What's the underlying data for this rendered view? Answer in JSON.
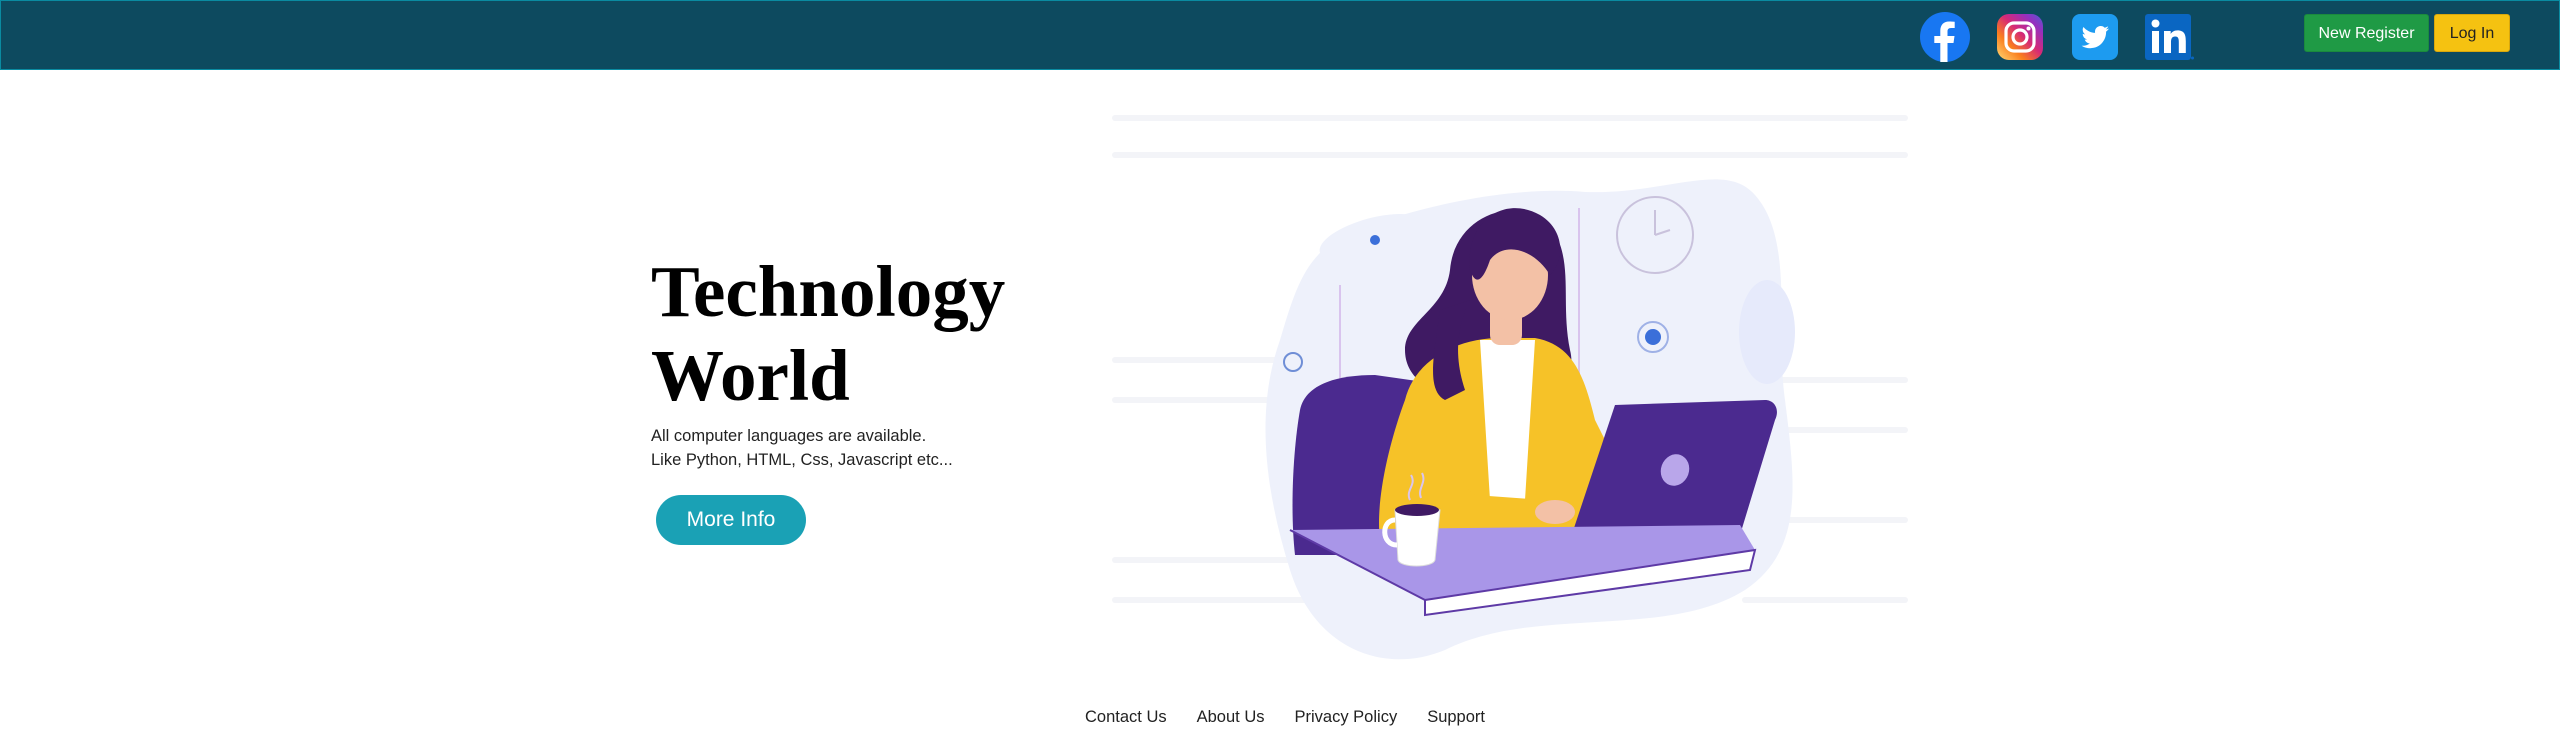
{
  "header": {
    "social": [
      {
        "icon": "facebook-icon",
        "color": "#1877f2"
      },
      {
        "icon": "instagram-icon",
        "color": "#c13584"
      },
      {
        "icon": "twitter-icon",
        "color": "#1d9bf0"
      },
      {
        "icon": "linkedin-icon",
        "color": "#0a66c2"
      }
    ],
    "register_label": "New Register",
    "login_label": "Log In",
    "colors": {
      "bar": "#0d4a5f",
      "register": "#1f9a45",
      "login": "#f5c211"
    }
  },
  "hero": {
    "title_line1": "Technology",
    "title_line2": "World",
    "desc_line1": "All computer languages are available.",
    "desc_line2": "Like Python, HTML, Css, Javascript etc...",
    "button_label": "More Info",
    "button_color": "#1aa1b5",
    "illustration": "woman-working-on-laptop-illustration"
  },
  "footer": {
    "links": [
      "Contact Us",
      "About Us",
      "Privacy Policy",
      "Support"
    ]
  }
}
